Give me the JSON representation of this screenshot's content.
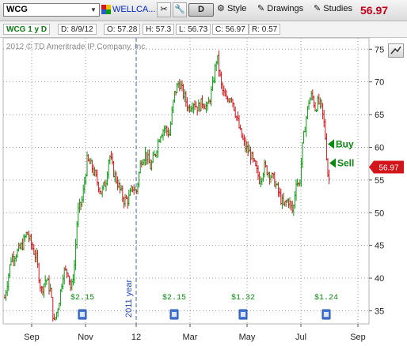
{
  "toolbar": {
    "symbol": "WCG",
    "company": "WELLCA...",
    "period_button": "D",
    "style_label": "Style",
    "drawings_label": "Drawings",
    "studies_label": "Studies",
    "last_price": "56.97"
  },
  "infobar": {
    "title": "WCG 1 y D",
    "date": "D: 8/9/12",
    "open": "O: 57.28",
    "high": "H: 57.3",
    "low": "L: 56.73",
    "close": "C: 56.97",
    "range": "R: 0.57"
  },
  "watermark": "2012 © TD Ameritrade IP Company, Inc.",
  "colors": {
    "up": "#0a9a10",
    "down": "#d2141b",
    "price_tag": "#d2141b",
    "buy_sell": "#0a8a10",
    "grid": "#9a9a9a"
  },
  "chart_data": {
    "type": "ohlc",
    "symbol": "WCG",
    "period": "1 y D",
    "ylim": [
      33,
      76
    ],
    "y_ticks": [
      35,
      40,
      45,
      50,
      55,
      60,
      65,
      70,
      75
    ],
    "x_ticks": [
      "Sep",
      "Nov",
      "12",
      "Mar",
      "May",
      "Jul",
      "Sep"
    ],
    "year_marker": "2011 year",
    "last_price": 56.97,
    "key_points": [
      {
        "month": "Aug 2011",
        "price": 37
      },
      {
        "month": "early Aug 2011",
        "price": 47
      },
      {
        "month": "late Aug 2011",
        "price": 33
      },
      {
        "month": "Oct 2011",
        "price": 50
      },
      {
        "month": "Nov 2011",
        "price": 58
      },
      {
        "month": "Dec 2011",
        "price": 52
      },
      {
        "month": "Jan 2012",
        "price": 59
      },
      {
        "month": "Feb 2012",
        "price": 70
      },
      {
        "month": "Mar 2012",
        "price": 74
      },
      {
        "month": "May 2012",
        "price": 60
      },
      {
        "month": "Jun 2012",
        "price": 50
      },
      {
        "month": "Jul 2012",
        "price": 68
      },
      {
        "month": "Aug 2012",
        "price": 55
      }
    ],
    "dividends": [
      {
        "label": "$2.15",
        "month": "Oct 2011"
      },
      {
        "label": "$2.15",
        "month": "Feb 2012"
      },
      {
        "label": "$1.32",
        "month": "May 2012"
      },
      {
        "label": "$1.24",
        "month": "Jul 2012"
      }
    ],
    "signals": [
      {
        "label": "Buy",
        "price": 60.5
      },
      {
        "label": "Sell",
        "price": 57.6
      }
    ]
  }
}
